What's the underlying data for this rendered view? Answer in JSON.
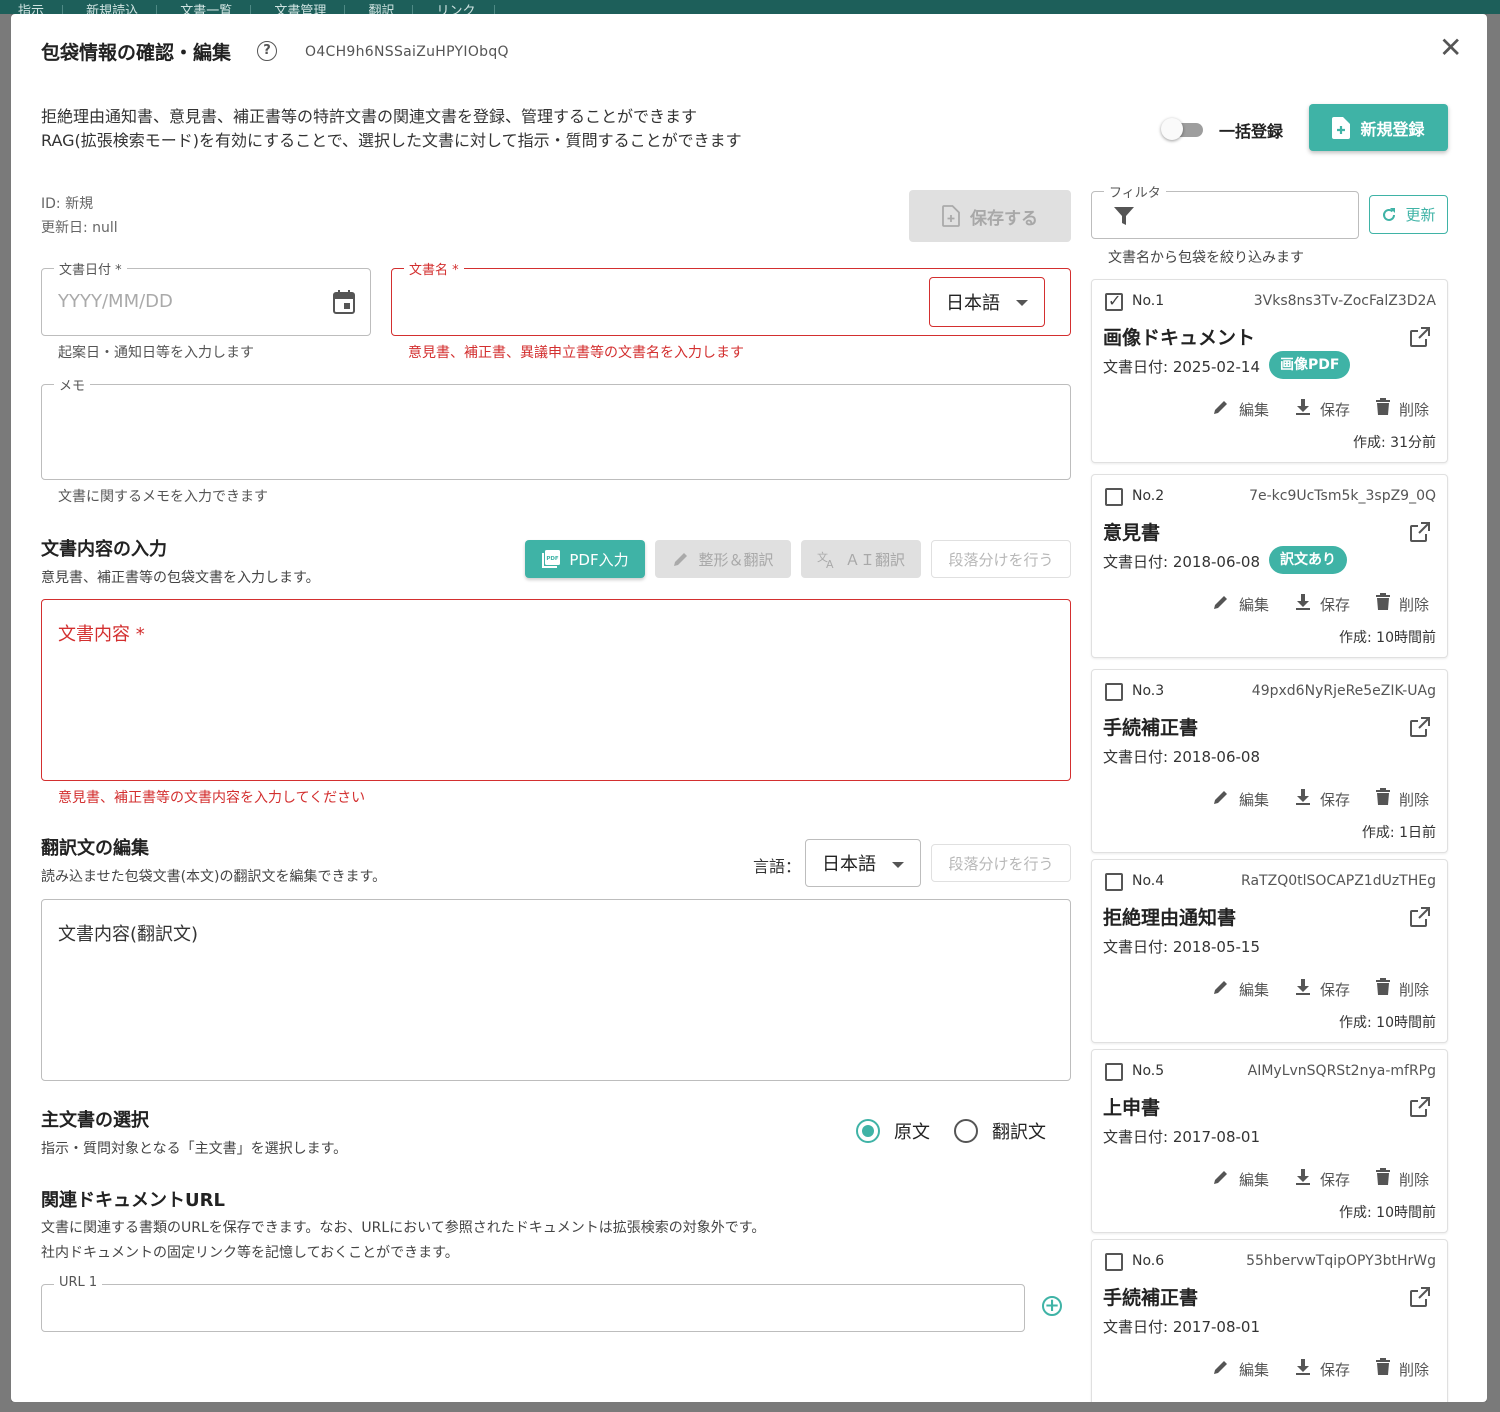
{
  "background": {
    "tabs": [
      "指示",
      "新規読込",
      "文書一覧",
      "文書管理",
      "翻訳",
      "リンク"
    ]
  },
  "dialog": {
    "title": "包袋情報の確認・編集",
    "doc_id": "O4CH9h6NSSaiZuHPYIObqQ",
    "description_line1": "拒絶理由通知書、意見書、補正書等の特許文書の関連文書を登録、管理することができます",
    "description_line2": "RAG(拡張検索モード)を有効にすることで、選択した文書に対して指示・質問することができます",
    "bulk_register_label": "一括登録",
    "new_register_label": "新規登録",
    "meta_id": "ID: 新規",
    "meta_updated": "更新日: null",
    "save_label": "保存する"
  },
  "form": {
    "date": {
      "label": "文書日付 *",
      "placeholder": "YYYY/MM/DD",
      "helper": "起案日・通知日等を入力します"
    },
    "name": {
      "label": "文書名 *",
      "language": "日本語",
      "helper": "意見書、補正書、異議申立書等の文書名を入力します"
    },
    "memo": {
      "label": "メモ",
      "helper": "文書に関するメモを入力できます"
    },
    "content_section": {
      "title": "文書内容の入力",
      "subtitle": "意見書、補正書等の包袋文書を入力します。",
      "pdf_button": "PDF入力",
      "format_translate_button": "整形＆翻訳",
      "ai_translate_button": "ＡＩ翻訳",
      "paragraph_button": "段落分けを行う",
      "content_label": "文書内容 *",
      "content_helper": "意見書、補正書等の文書内容を入力してください"
    },
    "translation_section": {
      "title": "翻訳文の編集",
      "subtitle": "読み込ませた包袋文書(本文)の翻訳文を編集できます。",
      "language_label": "言語：",
      "language": "日本語",
      "paragraph_button": "段落分けを行う",
      "content_label": "文書内容(翻訳文)"
    },
    "main_doc_section": {
      "title": "主文書の選択",
      "subtitle": "指示・質問対象となる「主文書」を選択します。",
      "option_original": "原文",
      "option_translation": "翻訳文",
      "selected": "原文"
    },
    "url_section": {
      "title": "関連ドキュメントURL",
      "subtitle_line1": "文書に関連する書類のURLを保存できます。なお、URLにおいて参照されたドキュメントは拡張検索の対象外です。",
      "subtitle_line2": "社内ドキュメントの固定リンク等を記憶しておくことができます。",
      "url1_label": "URL 1"
    }
  },
  "sidebar": {
    "filter_label": "フィルタ",
    "refresh_label": "更新",
    "filter_helper": "文書名から包袋を絞り込みます",
    "action_edit": "編集",
    "action_save": "保存",
    "action_delete": "削除",
    "documents": [
      {
        "no": "No.1",
        "id": "3Vks8ns3Tv-ZocFalZ3D2A",
        "title": "画像ドキュメント",
        "date": "文書日付: 2025-02-14",
        "badge": "画像PDF",
        "created": "作成: 31分前",
        "checked": true
      },
      {
        "no": "No.2",
        "id": "7e-kc9UcTsm5k_3spZ9_0Q",
        "title": "意見書",
        "date": "文書日付: 2018-06-08",
        "badge": "訳文あり",
        "created": "作成: 10時間前",
        "checked": false
      },
      {
        "no": "No.3",
        "id": "49pxd6NyRjeRe5eZIK-UAg",
        "title": "手続補正書",
        "date": "文書日付: 2018-06-08",
        "badge": "",
        "created": "作成: 1日前",
        "checked": false
      },
      {
        "no": "No.4",
        "id": "RaTZQ0tlSOCAPZ1dUzTHEg",
        "title": "拒絶理由通知書",
        "date": "文書日付: 2018-05-15",
        "badge": "",
        "created": "作成: 10時間前",
        "checked": false
      },
      {
        "no": "No.5",
        "id": "AIMyLvnSQRSt2nya-mfRPg",
        "title": "上申書",
        "date": "文書日付: 2017-08-01",
        "badge": "",
        "created": "作成: 10時間前",
        "checked": false
      },
      {
        "no": "No.6",
        "id": "55hbervwTqipOPY3btHrWg",
        "title": "手続補正書",
        "date": "文書日付: 2017-08-01",
        "badge": "",
        "created": "",
        "checked": false
      }
    ]
  },
  "colors": {
    "accent": "#3fb3a6",
    "error": "#d32f2f",
    "disabled": "#e0e0e0"
  }
}
